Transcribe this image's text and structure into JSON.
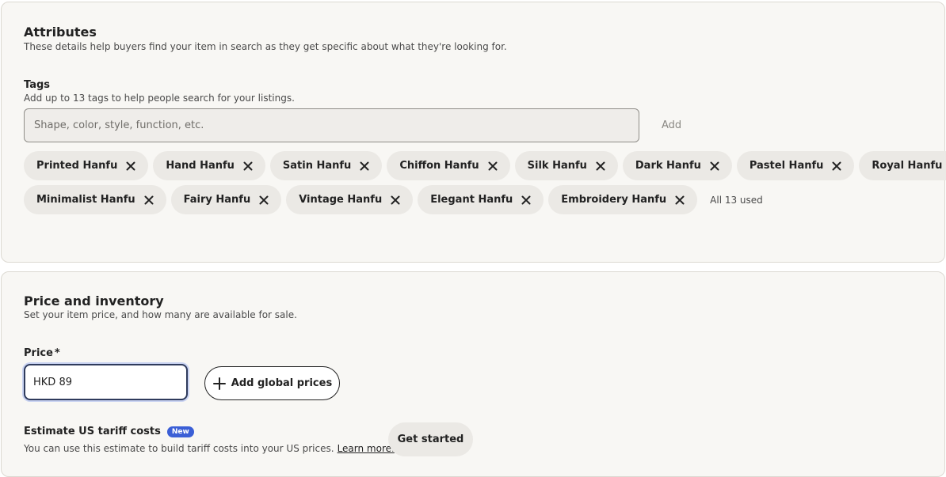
{
  "attributes": {
    "title": "Attributes",
    "description": "These details help buyers find your item in search as they get specific about what they're looking for."
  },
  "tags": {
    "label": "Tags",
    "help": "Add up to 13 tags to help people search for your listings.",
    "input_placeholder": "Shape, color, style, function, etc.",
    "input_value": "",
    "add_label": "Add",
    "rows": [
      [
        "Printed Hanfu",
        "Hand Hanfu",
        "Satin Hanfu",
        "Chiffon Hanfu",
        "Silk Hanfu",
        "Dark Hanfu",
        "Pastel Hanfu",
        "Royal Hanfu"
      ],
      [
        "Minimalist Hanfu",
        "Fairy Hanfu",
        "Vintage Hanfu",
        "Elegant Hanfu",
        "Embroidery Hanfu"
      ]
    ],
    "used_text": "All 13 used",
    "remove_icon": "close-icon"
  },
  "price_inventory": {
    "title": "Price and inventory",
    "description": "Set your item price, and how many are available for sale.",
    "price_label": "Price",
    "required_marker": "*",
    "price_value": "HKD 89",
    "global_prices_label": "Add global prices",
    "global_prices_icon": "plus-icon",
    "tariff_title": "Estimate US tariff costs",
    "new_badge": "New",
    "tariff_desc": "You can use this estimate to build tariff costs into your US prices.",
    "learn_more": "Learn more.",
    "get_started": "Get started"
  },
  "colors": {
    "card_bg": "#f8f7f4",
    "chip_bg": "#ebe9e5",
    "badge_blue": "#3b5fd6",
    "focus_ring": "#c9d3f2"
  }
}
